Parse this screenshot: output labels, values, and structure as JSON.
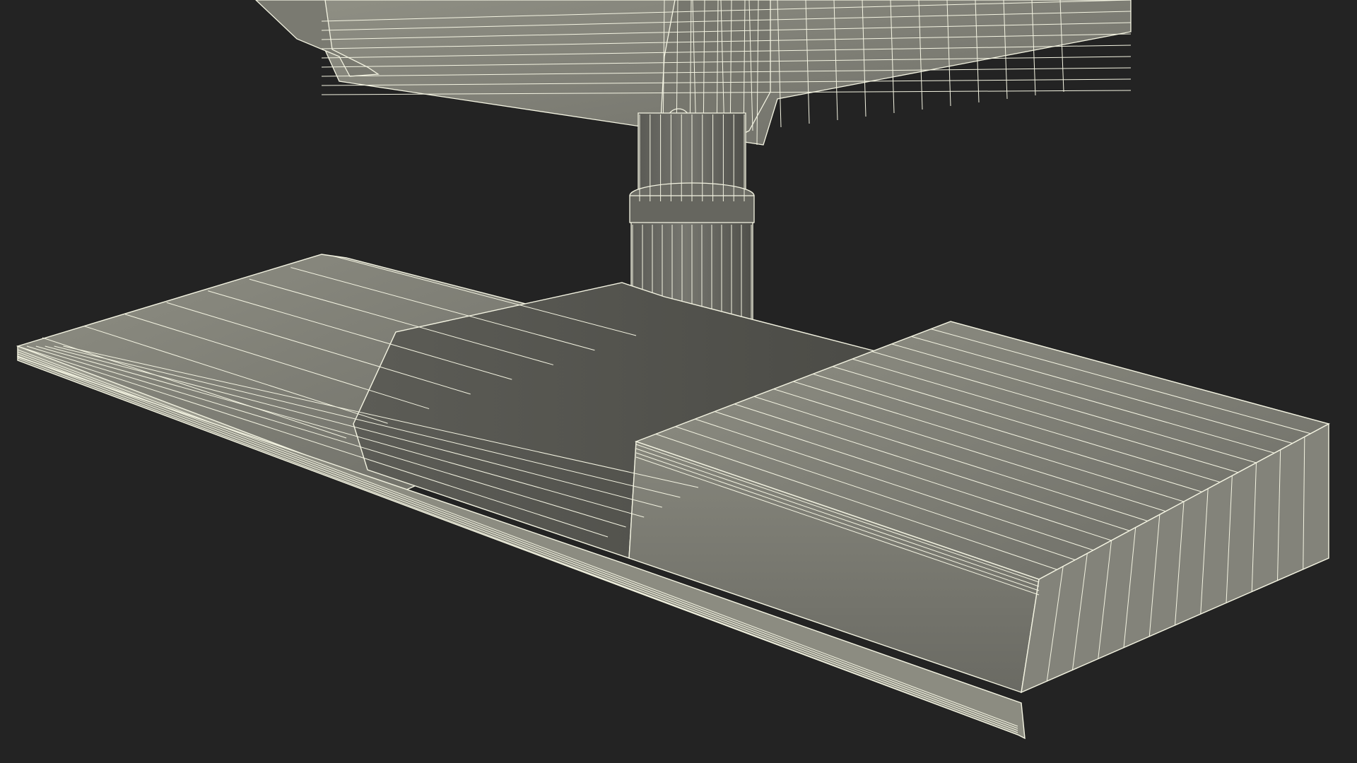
{
  "scene": {
    "subject": "wireframe-3d-render",
    "colors": {
      "background": "#232323",
      "surface_light": "#8a8a7e",
      "surface_mid": "#707068",
      "surface_dark": "#55554f",
      "wire": "#f4f4e2"
    }
  }
}
